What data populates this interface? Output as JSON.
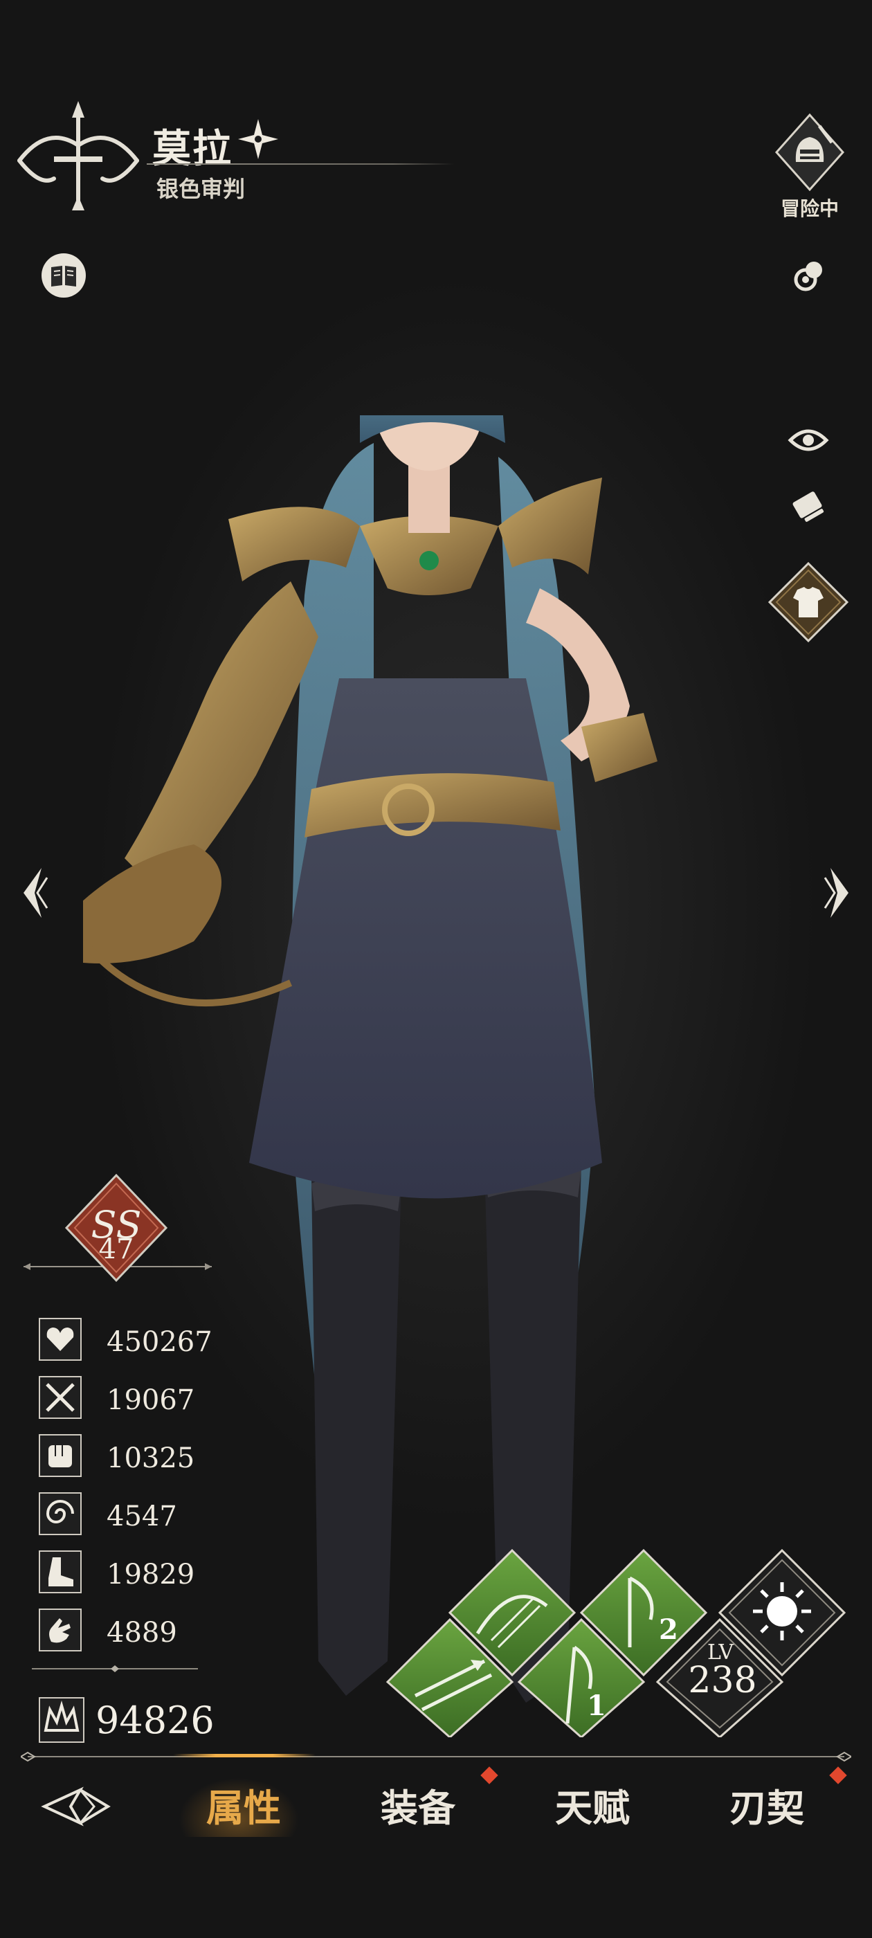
{
  "header": {
    "character_name": "莫拉",
    "character_title": "银色审判",
    "status_label": "冒险中"
  },
  "rank": {
    "grade": "SS",
    "level": "47"
  },
  "stats": [
    {
      "icon": "heart-icon",
      "value": "450267"
    },
    {
      "icon": "crossed-swords-icon",
      "value": "19067"
    },
    {
      "icon": "fist-icon",
      "value": "10325"
    },
    {
      "icon": "swirl-icon",
      "value": "4547"
    },
    {
      "icon": "boot-icon",
      "value": "19829"
    },
    {
      "icon": "hand-icon",
      "value": "4889"
    }
  ],
  "power": {
    "icon": "crown-wing-icon",
    "value": "94826"
  },
  "skills": {
    "level_label": "LV",
    "level_value": "238",
    "skill_numbers": [
      "1",
      "2"
    ]
  },
  "nav": {
    "tabs": [
      {
        "label": "属性",
        "active": true,
        "badge": false
      },
      {
        "label": "装备",
        "active": false,
        "badge": true
      },
      {
        "label": "天赋",
        "active": false,
        "badge": false
      },
      {
        "label": "刃契",
        "active": false,
        "badge": true
      }
    ]
  },
  "colors": {
    "background": "#1c1c1c",
    "accent": "#e7a94a",
    "rank_red": "#8a3424",
    "skill_green": "#4f8a2e",
    "badge_red": "#e2482e"
  }
}
